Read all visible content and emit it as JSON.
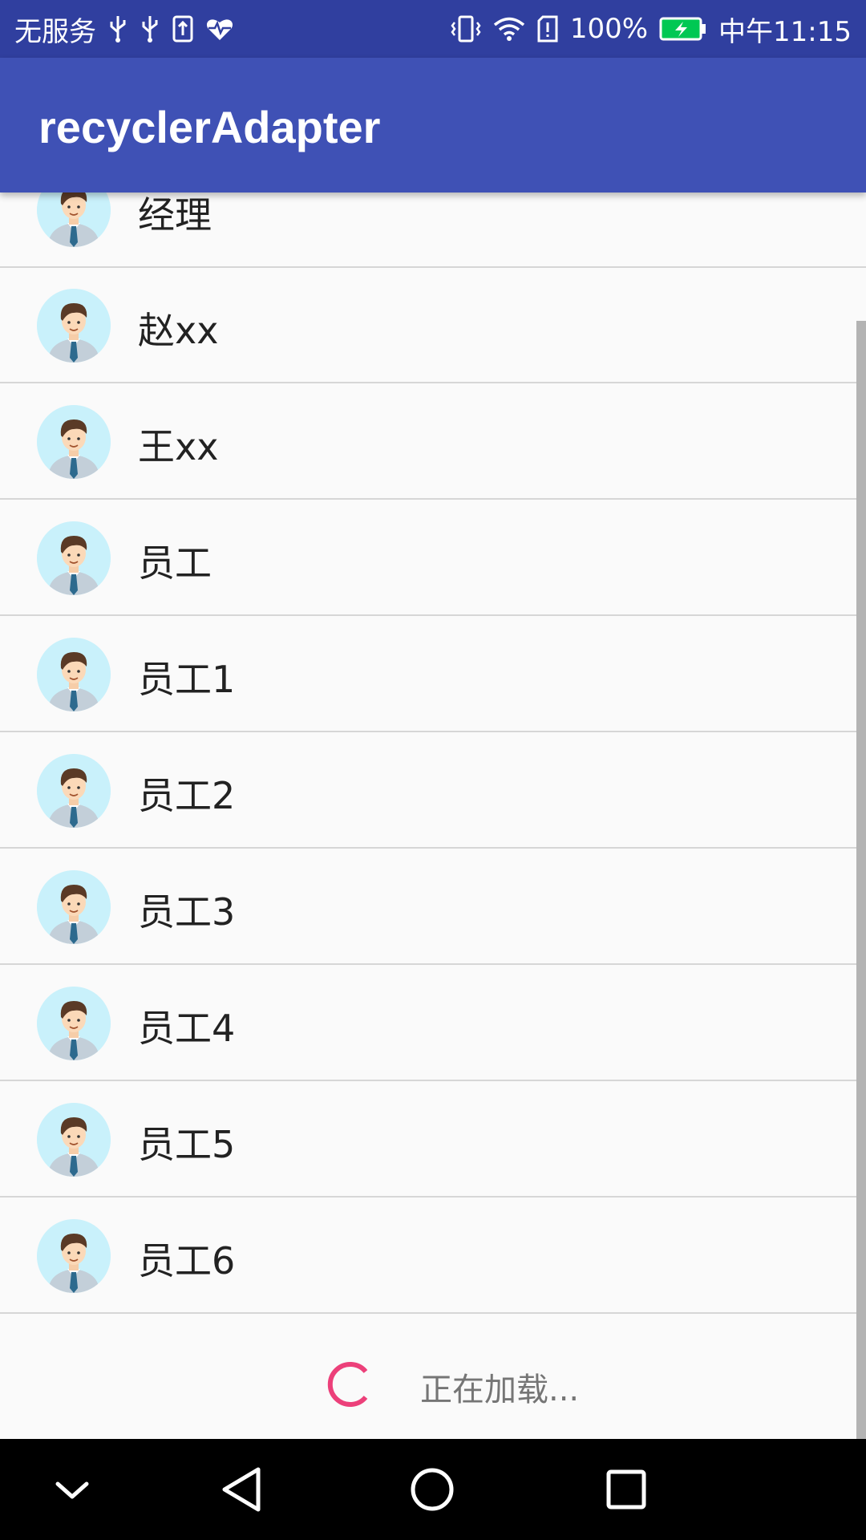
{
  "status_bar": {
    "carrier": "无服务",
    "battery": "100%",
    "time": "中午11:15",
    "icons_left": [
      "usb-icon",
      "usb-icon",
      "upload-icon",
      "heart-pulse-icon"
    ],
    "icons_right": [
      "vibrate-icon",
      "wifi-icon",
      "sim-alert-icon",
      "battery-charging-icon"
    ]
  },
  "app_bar": {
    "title": "recyclerAdapter"
  },
  "list": {
    "items": [
      {
        "label": "经理"
      },
      {
        "label": "赵xx"
      },
      {
        "label": "王xx"
      },
      {
        "label": "员工"
      },
      {
        "label": "员工1"
      },
      {
        "label": "员工2"
      },
      {
        "label": "员工3"
      },
      {
        "label": "员工4"
      },
      {
        "label": "员工5"
      },
      {
        "label": "员工6"
      }
    ],
    "avatar_icon": "businessman-avatar-icon"
  },
  "loading": {
    "text": "正在加载..."
  },
  "nav_bar": {
    "buttons": [
      "chevron-down-icon",
      "back-triangle-icon",
      "home-circle-icon",
      "recents-square-icon"
    ]
  },
  "colors": {
    "status_bar": "#303f9f",
    "app_bar": "#3f51b5",
    "spinner": "#ec407a",
    "background": "#fafafa"
  }
}
